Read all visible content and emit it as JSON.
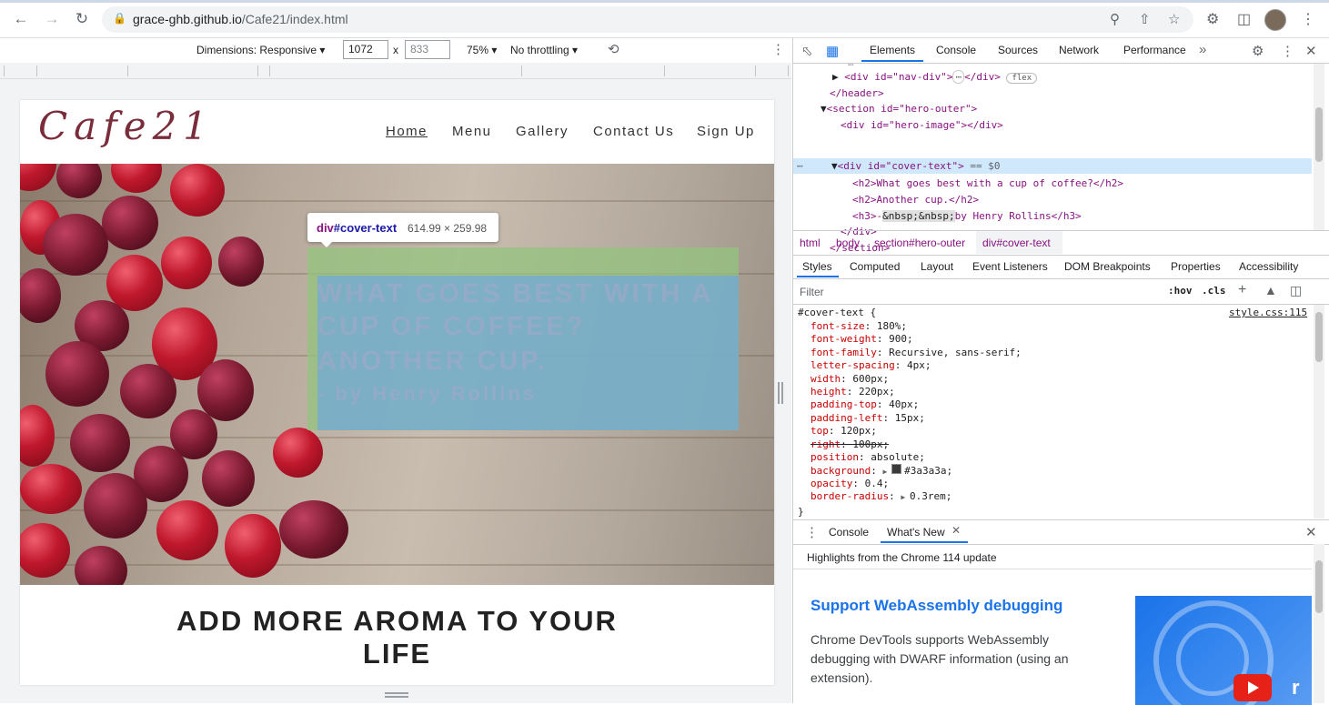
{
  "browser": {
    "url_host": "grace-ghb.github.io",
    "url_path": "/Cafe21/index.html"
  },
  "device_toolbar": {
    "dimensions_label": "Dimensions: Responsive",
    "width": "1072",
    "height": "833",
    "zoom": "75%",
    "throttling": "No throttling"
  },
  "page": {
    "logo": "Cafe21",
    "nav": [
      "Home",
      "Menu",
      "Gallery",
      "Contact Us",
      "Sign Up"
    ],
    "cover_lines": [
      "WHAT GOES BEST WITH A",
      "CUP OF COFFEE?",
      "ANOTHER CUP.",
      "-  by Henry Rollins"
    ],
    "tooltip_tag": "div",
    "tooltip_id": "#cover-text",
    "tooltip_size": "614.99 × 259.98",
    "heading_line1": "ADD MORE AROMA TO YOUR",
    "heading_line2": "LIFE"
  },
  "devtools": {
    "tabs": [
      "Elements",
      "Console",
      "Sources",
      "Network",
      "Performance"
    ],
    "dom": {
      "nav_div_open": "<div id=\"nav-div\">",
      "nav_div_close": "</div>",
      "flex_badge": "flex",
      "header_close": "</header>",
      "section_open": "<section id=\"hero-outer\">",
      "hero_image": "<div id=\"hero-image\"></div>",
      "cover_open": "<div id=\"cover-text\">",
      "selected_marker": "== $0",
      "h2a": "<h2>What goes best with a cup of coffee?</h2>",
      "h2b": "<h2>Another cup.</h2>",
      "h3_prefix": "<h3>-",
      "h3_nbsp": "&nbsp;&nbsp;",
      "h3_suffix": "by Henry Rollins</h3>",
      "div_close": "</div>",
      "section_close": "</section>"
    },
    "breadcrumbs": [
      "html",
      "body",
      "section#hero-outer",
      "div#cover-text"
    ],
    "style_tabs": [
      "Styles",
      "Computed",
      "Layout",
      "Event Listeners",
      "DOM Breakpoints",
      "Properties",
      "Accessibility"
    ],
    "filter_placeholder": "Filter",
    "hov": ":hov",
    "cls": ".cls",
    "rule_selector": "#cover-text {",
    "rule_source": "style.css:115",
    "rule_close": "}",
    "declarations": [
      {
        "name": "font-size",
        "value": "180%;"
      },
      {
        "name": "font-weight",
        "value": "900;"
      },
      {
        "name": "font-family",
        "value": "Recursive, sans-serif;"
      },
      {
        "name": "letter-spacing",
        "value": "4px;"
      },
      {
        "name": "width",
        "value": "600px;"
      },
      {
        "name": "height",
        "value": "220px;"
      },
      {
        "name": "padding-top",
        "value": "40px;"
      },
      {
        "name": "padding-left",
        "value": "15px;"
      },
      {
        "name": "top",
        "value": "120px;"
      },
      {
        "name": "right",
        "value": "100px;",
        "struck": true
      },
      {
        "name": "position",
        "value": "absolute;"
      },
      {
        "name": "background",
        "value": "#3a3a3a;"
      },
      {
        "name": "opacity",
        "value": "0.4;"
      },
      {
        "name": "border-radius",
        "value": "0.3rem;"
      }
    ],
    "drawer_tabs": [
      "Console",
      "What's New"
    ],
    "whatsnew_title": "Highlights from the Chrome 114 update",
    "whatsnew_heading": "Support WebAssembly debugging",
    "whatsnew_body": "Chrome DevTools supports WebAssembly debugging with DWARF information (using an extension).",
    "whatsnew_body_lines": [
      "Chrome DevTools supports WebAssembly",
      "debugging with DWARF information (using an",
      "extension)."
    ]
  },
  "colors": {
    "accent": "#1a73e8",
    "logo": "#7a2c3a",
    "highlight_padding": "#93c47d",
    "highlight_content": "#6fa8dc"
  }
}
